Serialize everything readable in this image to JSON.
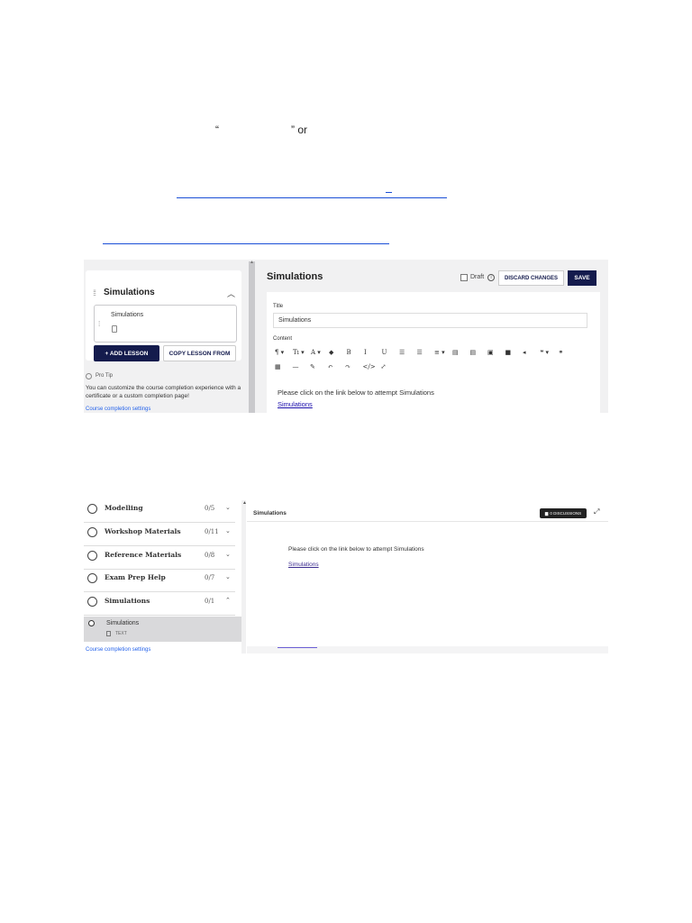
{
  "document": {
    "open_quote": "“",
    "close_quote": "” or"
  },
  "editor": {
    "sidebar": {
      "chapter_title": "Simulations",
      "lesson_name": "Simulations",
      "add_lesson_label": "+ ADD LESSON",
      "copy_lesson_label": "COPY LESSON FROM",
      "pro_tip_label": "Pro Tip",
      "pro_tip_text": "You can customize the course completion experience with a certificate or a custom completion page!",
      "settings_link": "Course completion settings"
    },
    "main": {
      "title": "Simulations",
      "draft_label": "Draft",
      "discard_label": "DISCARD CHANGES",
      "save_label": "SAVE",
      "title_field_label": "Title",
      "title_field_value": "Simulations",
      "content_label": "Content",
      "toolbar": {
        "row1": [
          "¶ ▾",
          "Tı ▾",
          "A ▾",
          "◆",
          "B",
          "I",
          "U",
          "☰",
          "☰",
          "≡ ▾",
          "▤",
          "▤",
          "▣",
          "■",
          "◂",
          "❝ ▾",
          "⚭"
        ],
        "row2": [
          "▦",
          "—",
          "✎",
          "↶",
          "↷",
          "</>",
          "⤢"
        ]
      },
      "content_text": "Please click on the link below to attempt Simulations",
      "content_link": "Simulations"
    }
  },
  "preview": {
    "chapters": [
      {
        "name": "Modelling",
        "count": "0/5",
        "chevron": "⌄"
      },
      {
        "name": "Workshop Materials",
        "count": "0/11",
        "chevron": "⌄"
      },
      {
        "name": "Reference Materials",
        "count": "0/8",
        "chevron": "⌄"
      },
      {
        "name": "Exam Prep Help",
        "count": "0/7",
        "chevron": "⌄"
      },
      {
        "name": "Simulations",
        "count": "0/1",
        "chevron": "⌃"
      }
    ],
    "selected_lesson": {
      "name": "Simulations",
      "type": "TEXT"
    },
    "settings_link": "Course completion settings",
    "header_title": "Simulations",
    "discussions_label": "0 DISCUSSIONS",
    "body_text": "Please click on the link below to attempt Simulations",
    "body_link": "Simulations"
  }
}
